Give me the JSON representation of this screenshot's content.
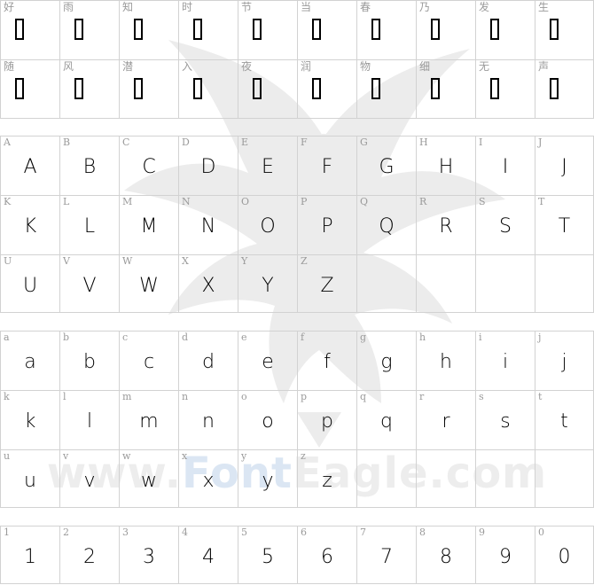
{
  "watermark": {
    "text_prefix": "www.",
    "text_accent": "Font",
    "text_suffix": "Eagle.com",
    "icon": "eagle-icon"
  },
  "chinese": {
    "labels": [
      "好",
      "雨",
      "知",
      "时",
      "节",
      "当",
      "春",
      "乃",
      "发",
      "生",
      "随",
      "风",
      "潜",
      "入",
      "夜",
      "润",
      "物",
      "细",
      "无",
      "声"
    ]
  },
  "uppercase": {
    "labels": [
      "A",
      "B",
      "C",
      "D",
      "E",
      "F",
      "G",
      "H",
      "I",
      "J",
      "K",
      "L",
      "M",
      "N",
      "O",
      "P",
      "Q",
      "R",
      "S",
      "T",
      "U",
      "V",
      "W",
      "X",
      "Y",
      "Z"
    ]
  },
  "lowercase": {
    "labels": [
      "a",
      "b",
      "c",
      "d",
      "e",
      "f",
      "g",
      "h",
      "i",
      "j",
      "k",
      "l",
      "m",
      "n",
      "o",
      "p",
      "q",
      "r",
      "s",
      "t",
      "u",
      "v",
      "w",
      "x",
      "y",
      "z"
    ]
  },
  "digits": {
    "labels": [
      "1",
      "2",
      "3",
      "4",
      "5",
      "6",
      "7",
      "8",
      "9",
      "0"
    ]
  }
}
